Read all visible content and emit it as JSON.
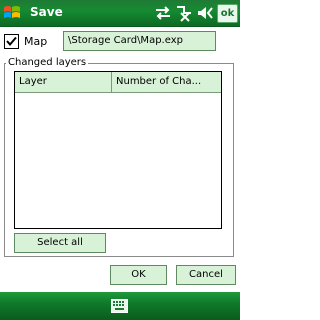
{
  "titlebar": {
    "title": "Save",
    "ok_label": "ok",
    "icons": [
      "windows-start-icon",
      "connectivity-icon",
      "no-signal-icon",
      "volume-icon"
    ]
  },
  "map": {
    "label": "Map",
    "checked": true,
    "path": "\\Storage Card\\Map.exp"
  },
  "changed_layers": {
    "legend": "Changed layers",
    "columns": [
      "Layer",
      "Number of Cha..."
    ],
    "rows": []
  },
  "buttons": {
    "select_all": "Select all",
    "ok": "OK",
    "cancel": "Cancel"
  },
  "bottombar": {
    "icon": "keyboard-icon"
  },
  "colors": {
    "titlebar_green": "#168a32",
    "control_fill": "#d8f2d8"
  }
}
